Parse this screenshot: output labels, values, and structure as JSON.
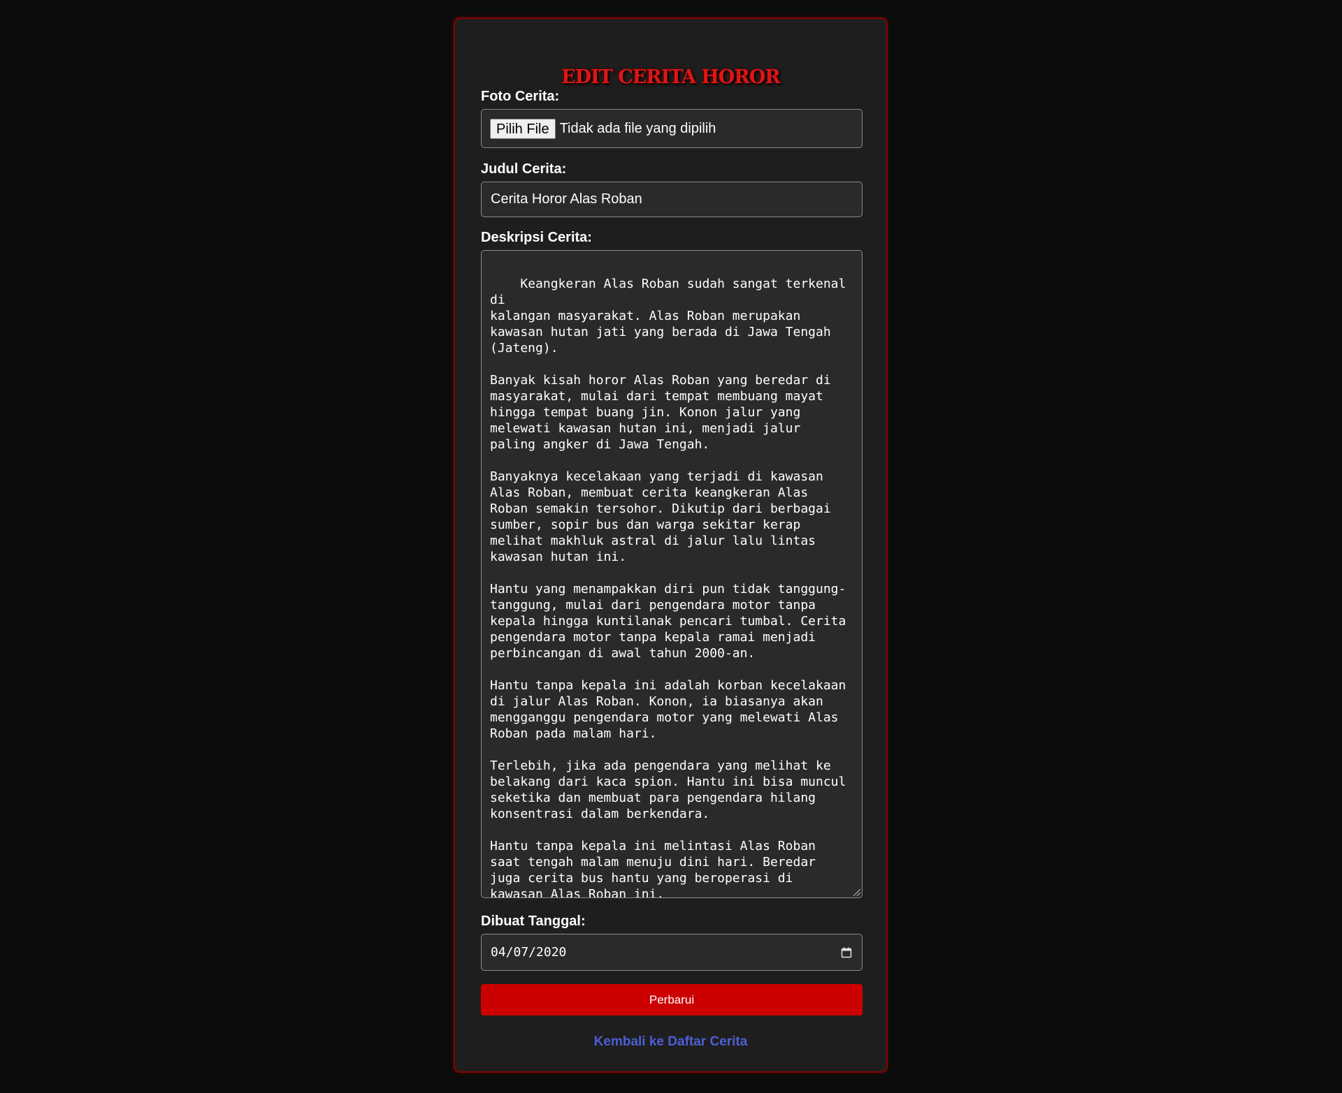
{
  "form": {
    "title": "EDIT CERITA HOROR",
    "photo": {
      "label": "Foto Cerita:",
      "button_label": "Pilih File",
      "status": "Tidak ada file yang dipilih"
    },
    "story_title": {
      "label": "Judul Cerita:",
      "value": "Cerita Horor Alas Roban"
    },
    "description": {
      "label": "Deskripsi Cerita:",
      "value": "Keangkeran Alas Roban sudah sangat terkenal di\nkalangan masyarakat. Alas Roban merupakan\nkawasan hutan jati yang berada di Jawa Tengah\n(Jateng).\n\nBanyak kisah horor Alas Roban yang beredar di\nmasyarakat, mulai dari tempat membuang mayat\nhingga tempat buang jin. Konon jalur yang\nmelewati kawasan hutan ini, menjadi jalur\npaling angker di Jawa Tengah.\n\nBanyaknya kecelakaan yang terjadi di kawasan\nAlas Roban, membuat cerita keangkeran Alas\nRoban semakin tersohor. Dikutip dari berbagai\nsumber, sopir bus dan warga sekitar kerap\nmelihat makhluk astral di jalur lalu lintas\nkawasan hutan ini.\n\nHantu yang menampakkan diri pun tidak tanggung-\ntanggung, mulai dari pengendara motor tanpa\nkepala hingga kuntilanak pencari tumbal. Cerita\npengendara motor tanpa kepala ramai menjadi\nperbincangan di awal tahun 2000-an.\n\nHantu tanpa kepala ini adalah korban kecelakaan\ndi jalur Alas Roban. Konon, ia biasanya akan\nmengganggu pengendara motor yang melewati Alas\nRoban pada malam hari.\n\nTerlebih, jika ada pengendara yang melihat ke\nbelakang dari kaca spion. Hantu ini bisa muncul\nseketika dan membuat para pengendara hilang\nkonsentrasi dalam berkendara.\n\nHantu tanpa kepala ini melintasi Alas Roban\nsaat tengah malam menuju dini hari. Beredar\njuga cerita bus hantu yang beroperasi di\nkawasan Alas Roban ini."
    },
    "created_date": {
      "label": "Dibuat Tanggal:",
      "value": "04/07/2020",
      "icon": "calendar-icon"
    },
    "submit_label": "Perbarui",
    "back_link": "Kembali ke Daftar Cerita"
  },
  "colors": {
    "background": "#0c0c0c",
    "card": "#1e1e1e",
    "card_border": "#8b0000",
    "accent": "#cc0000",
    "title": "#e11515",
    "link": "#4d5fd6"
  }
}
